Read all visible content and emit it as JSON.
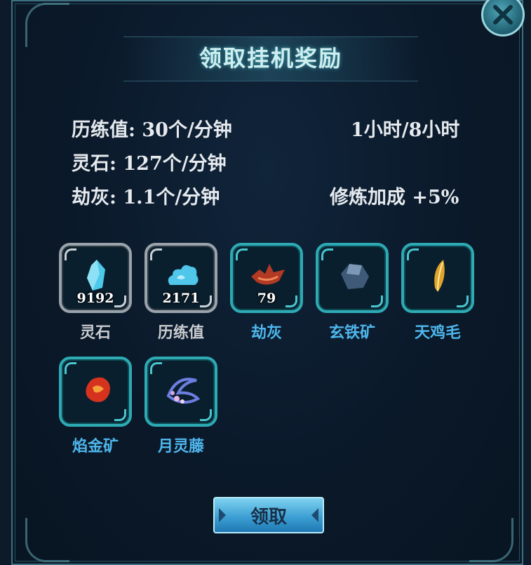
{
  "window": {
    "title": "领取挂机奖励",
    "close_icon": "close-icon"
  },
  "stats": {
    "exp_label": "历练值:",
    "exp_rate": "30个/分钟",
    "stone_label": "灵石:",
    "stone_rate": "127个/分钟",
    "ash_label": "劫灰:",
    "ash_rate": "1.1个/分钟",
    "time": "1小时/8小时",
    "bonus": "修炼加成 +5%"
  },
  "rewards": [
    {
      "name": "灵石",
      "count": "9192",
      "icon": "blue-crystal-icon",
      "style": "silver"
    },
    {
      "name": "历练值",
      "count": "2171",
      "icon": "cloud-icon",
      "style": "silver"
    },
    {
      "name": "劫灰",
      "count": "79",
      "icon": "red-ash-icon",
      "style": "teal"
    },
    {
      "name": "玄铁矿",
      "count": "",
      "icon": "dark-ore-icon",
      "style": "teal"
    },
    {
      "name": "天鸡毛",
      "count": "",
      "icon": "golden-feather-icon",
      "style": "teal"
    },
    {
      "name": "焰金矿",
      "count": "",
      "icon": "flame-ore-icon",
      "style": "teal"
    },
    {
      "name": "月灵藤",
      "count": "",
      "icon": "moon-vine-icon",
      "style": "teal"
    }
  ],
  "actions": {
    "claim_label": "领取"
  },
  "colors": {
    "accent_teal": "#2eaab4",
    "label_blue": "#4eb6ec",
    "button_blue": "#3da0d4"
  }
}
